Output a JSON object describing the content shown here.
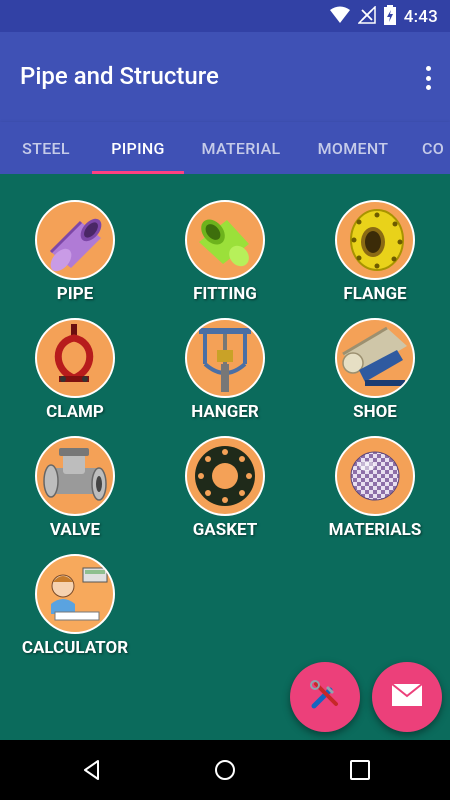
{
  "status_bar": {
    "time": "4:43"
  },
  "app_bar": {
    "title": "Pipe and Structure"
  },
  "tabs": [
    {
      "label": "STEEL"
    },
    {
      "label": "PIPING"
    },
    {
      "label": "MATERIAL"
    },
    {
      "label": "MOMENT"
    },
    {
      "label": "CO"
    }
  ],
  "active_tab": "PIPING",
  "items": [
    {
      "label": "PIPE",
      "icon": "pipe-icon"
    },
    {
      "label": "FITTING",
      "icon": "fitting-icon"
    },
    {
      "label": "FLANGE",
      "icon": "flange-icon"
    },
    {
      "label": "CLAMP",
      "icon": "clamp-icon"
    },
    {
      "label": "HANGER",
      "icon": "hanger-icon"
    },
    {
      "label": "SHOE",
      "icon": "shoe-icon"
    },
    {
      "label": "VALVE",
      "icon": "valve-icon"
    },
    {
      "label": "GASKET",
      "icon": "gasket-icon"
    },
    {
      "label": "MATERIALS",
      "icon": "materials-icon"
    },
    {
      "label": "CALCULATOR",
      "icon": "calculator-icon"
    }
  ],
  "colors": {
    "primary": "#3f51b5",
    "primary_dark": "#3241a5",
    "accent": "#ff4081",
    "background": "#0b6b5c",
    "icon_circle": "#f4a157",
    "fab": "#ec407a"
  }
}
